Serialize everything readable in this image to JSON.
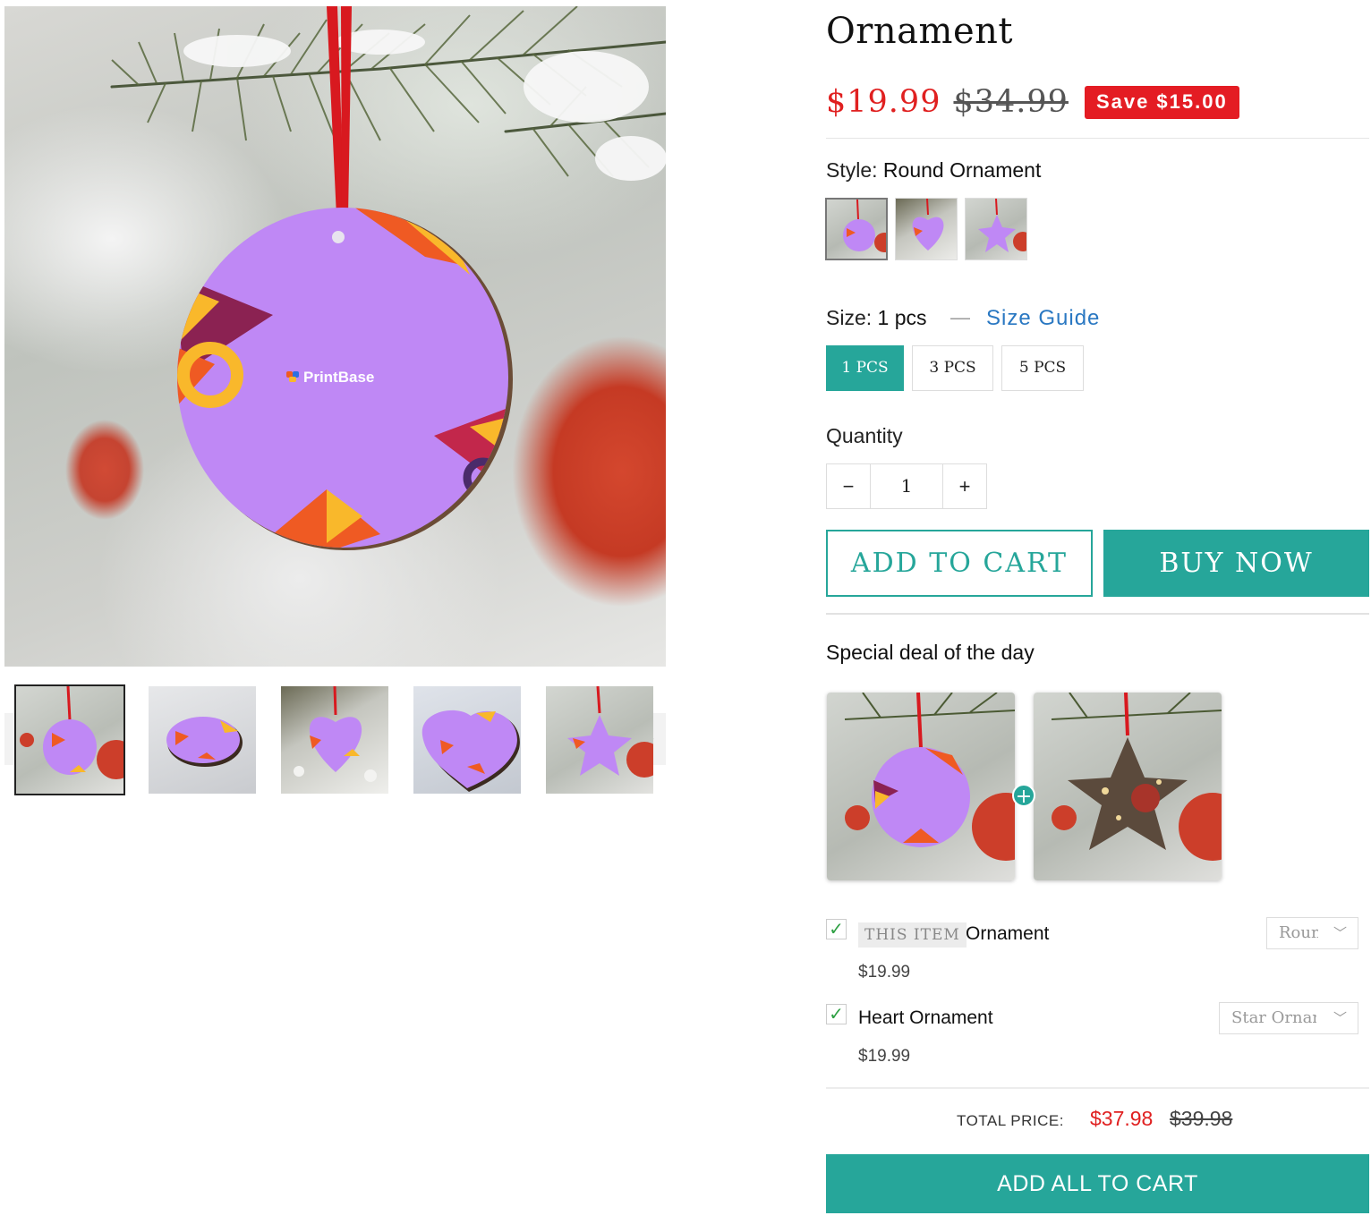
{
  "product": {
    "title": "Ornament",
    "price": "$19.99",
    "compare_price": "$34.99",
    "save_badge": "Save $15.00"
  },
  "colors": {
    "accent": "#26a69a",
    "sale_red": "#e02020",
    "link_blue": "#2a78c2",
    "ornament_purple": "#bf88f5"
  },
  "gallery": {
    "main_image_logo_text": "PrintBase",
    "prev_icon": "chevron-left-icon",
    "next_icon": "chevron-right-icon",
    "thumbnails": [
      {
        "shape": "round",
        "active": true
      },
      {
        "shape": "round-flat"
      },
      {
        "shape": "heart-tree"
      },
      {
        "shape": "heart-flat"
      },
      {
        "shape": "star"
      }
    ]
  },
  "style_option": {
    "label": "Style:",
    "value": "Round Ornament",
    "swatches": [
      "round",
      "heart",
      "star"
    ]
  },
  "size_option": {
    "label": "Size:",
    "value": "1 pcs",
    "separator": "—",
    "guide_link": "Size Guide",
    "options": [
      "1 PCS",
      "3 PCS",
      "5 PCS"
    ],
    "selected": "1 PCS"
  },
  "quantity": {
    "label": "Quantity",
    "minus": "−",
    "value": "1",
    "plus": "+"
  },
  "actions": {
    "add_to_cart": "ADD TO CART",
    "buy_now": "BUY NOW"
  },
  "deal": {
    "title": "Special deal of the day",
    "plus_icon": "plus-icon",
    "items": [
      {
        "badge": "THIS ITEM",
        "name": "Ornament",
        "price": "$19.99",
        "checked": true,
        "select_value": "Round Ornament"
      },
      {
        "name": "Heart Ornament",
        "price": "$19.99",
        "checked": true,
        "select_value": "Star Ornament"
      }
    ],
    "total_label": "TOTAL PRICE:",
    "total_price": "$37.98",
    "total_compare": "$39.98",
    "add_all": "ADD ALL TO CART"
  }
}
